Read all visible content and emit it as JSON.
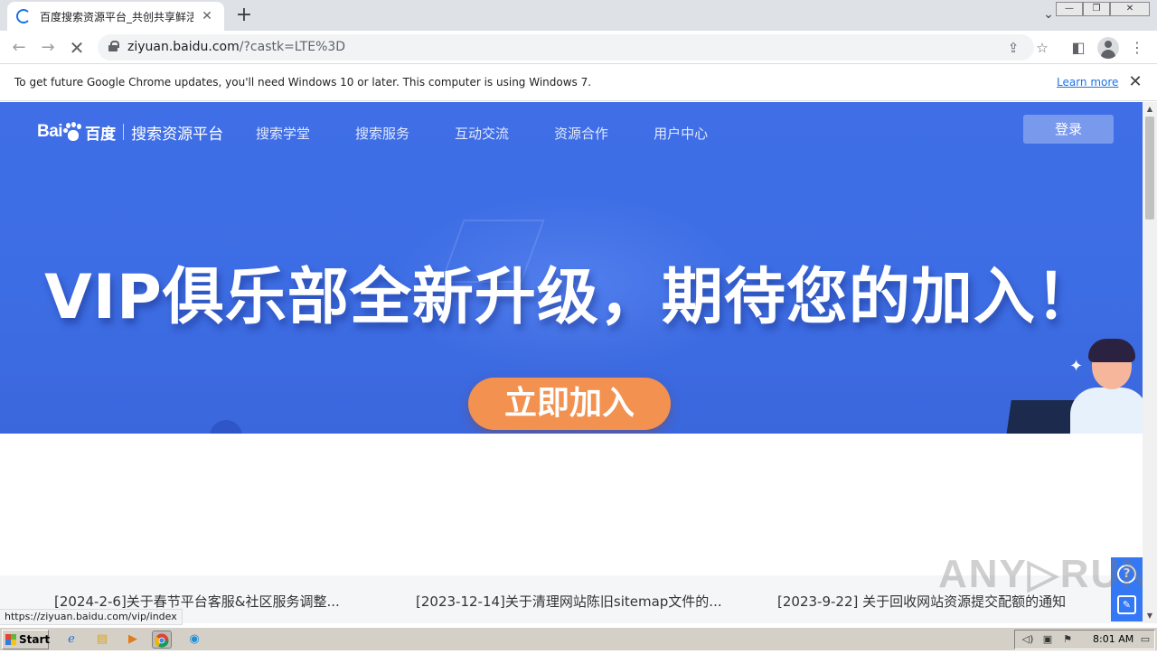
{
  "browser": {
    "tab_title": "百度搜索资源平台_共创共享鲜活搜索",
    "tab_close_glyph": "✕",
    "new_tab_glyph": "+",
    "url_host": "ziyuan.baidu.com",
    "url_path": "/?castk=LTE%3D",
    "infobar_message": "To get future Google Chrome updates, you'll need Windows 10 or later. This computer is using Windows 7.",
    "infobar_link": "Learn more",
    "infobar_close_glyph": "✕",
    "status_url": "https://ziyuan.baidu.com/vip/index"
  },
  "site": {
    "logo_latin": "Bai",
    "logo_cn": "百度",
    "platform_name": "搜索资源平台",
    "nav": [
      "搜索学堂",
      "搜索服务",
      "互动交流",
      "资源合作",
      "用户中心"
    ],
    "login_label": "登录"
  },
  "hero": {
    "headline": "VIP俱乐部全新升级，期待您的加入！",
    "cta_label": "立即加入",
    "accent_color": "#3f6ee6",
    "cta_color": "#f29150"
  },
  "news": [
    "[2024-2-6]关于春节平台客服&社区服务调整...",
    "[2023-12-14]关于清理网站陈旧sitemap文件的...",
    "[2023-9-22] 关于回收网站资源提交配额的通知"
  ],
  "float_tools": {
    "help_glyph": "?",
    "feedback_glyph": "✎"
  },
  "watermark": "ANY▷RUN",
  "taskbar": {
    "start_label": "Start",
    "clock": "8:01 AM"
  }
}
